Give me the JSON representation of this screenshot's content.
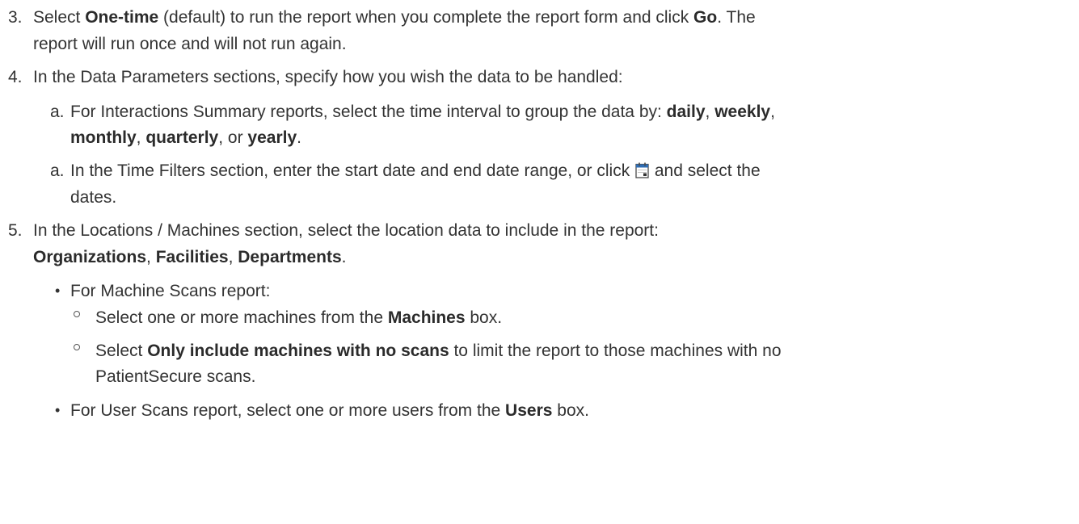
{
  "step3": {
    "number": "3.",
    "t1": "Select ",
    "b1": "One-time",
    "t2": " (default) to run the report when you complete the report form and click ",
    "b2": "Go",
    "t3": ". The",
    "line2": "report will run once and will not run again."
  },
  "step4": {
    "number": "4.",
    "text": "In the Data Parameters sections, specify how you wish the data to be handled:",
    "sub_a1": {
      "letter": "a.",
      "t1": "For Interactions Summary reports, select the time interval to group the data by: ",
      "b_daily": "daily",
      "sep1": ", ",
      "b_weekly": "weekly",
      "sep2": ",",
      "b_monthly": "monthly",
      "sep3": ", ",
      "b_quarterly": "quarterly",
      "sep4": ", or ",
      "b_yearly": "yearly",
      "end": "."
    },
    "sub_a2": {
      "letter": "a.",
      "t1": "In the Time Filters section, enter the start date and end date range, or click ",
      "t2": " and select the",
      "line2": "dates.",
      "icon": "calendar-icon"
    }
  },
  "step5": {
    "number": "5.",
    "text": "In the Locations / Machines section, select the location data to include in the report:",
    "b_org": "Organizations",
    "sep1": ", ",
    "b_fac": "Facilities",
    "sep2": ", ",
    "b_dep": "Departments",
    "end": ".",
    "bullet1": {
      "text": "For Machine Scans report:",
      "sub1": {
        "t1": "Select one or more machines from the ",
        "b1": "Machines",
        "t2": " box."
      },
      "sub2": {
        "t1": "Select ",
        "b1": "Only include machines with no scans",
        "t2": " to limit the report to those machines with no",
        "line2": "PatientSecure scans."
      }
    },
    "bullet2": {
      "t1": "For User Scans report, select one or more users from the ",
      "b1": "Users",
      "t2": " box."
    }
  },
  "colors": {
    "text": "#333333",
    "calendar_accent": "#2e6db4"
  }
}
